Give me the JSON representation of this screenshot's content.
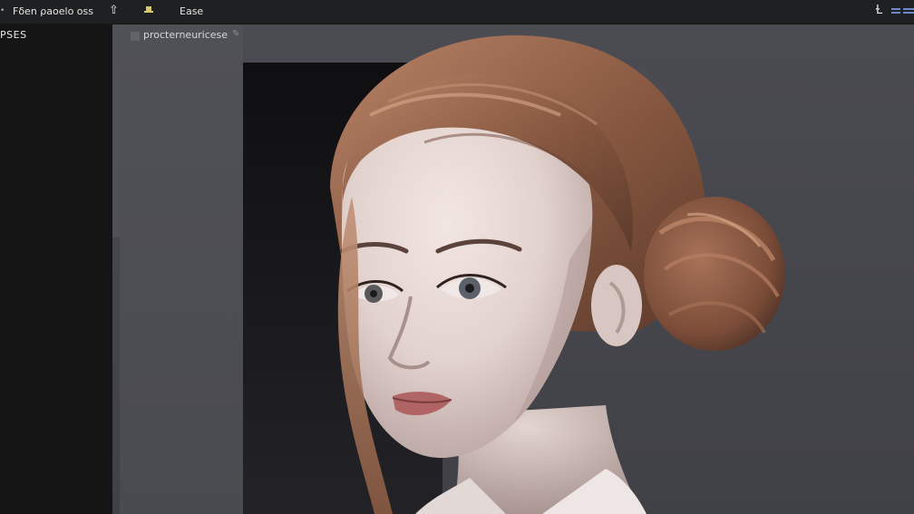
{
  "topbar": {
    "title": "Fδen ρaoelo oss",
    "tab": "Ease",
    "icons": [
      "cursor-icon",
      "pin-icon",
      "text-tool-icon",
      "layers-icon"
    ]
  },
  "sidebar": {
    "label": "PSES"
  },
  "document": {
    "tab_label": "procterneuricese"
  },
  "colors": {
    "topbar": "#1f2021",
    "sidebar": "#151516",
    "canvas": "#46474c",
    "hair": "#8a5a42",
    "skin": "#e6d8d4"
  }
}
